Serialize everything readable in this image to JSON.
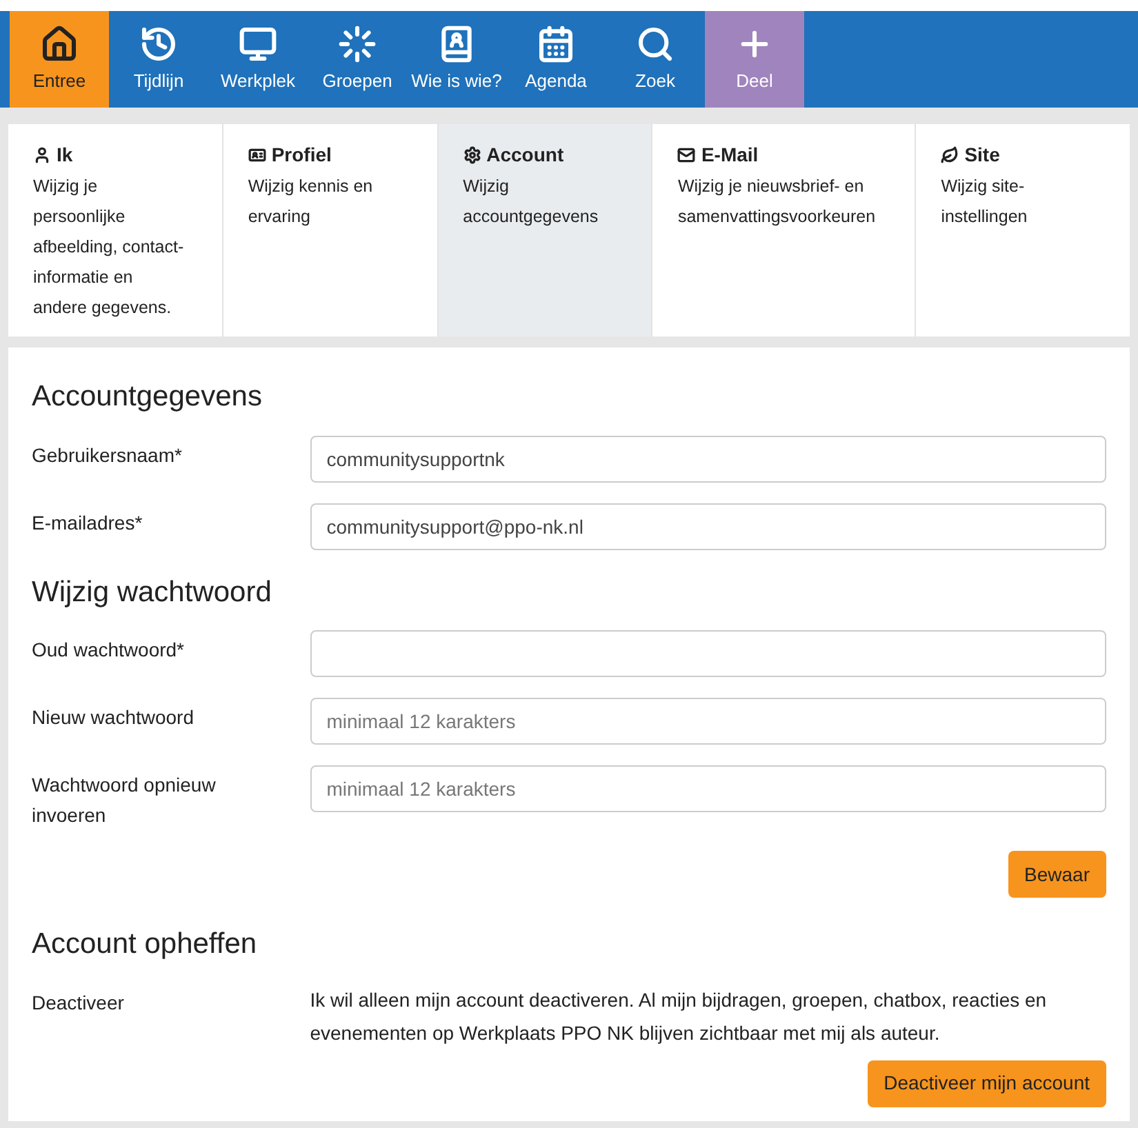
{
  "nav": [
    {
      "label": "Entree",
      "selected": true,
      "kind": "link"
    },
    {
      "label": "Tijdlijn",
      "selected": false,
      "kind": "link"
    },
    {
      "label": "Werkplek",
      "selected": false,
      "kind": "link"
    },
    {
      "label": "Groepen",
      "selected": false,
      "kind": "link"
    },
    {
      "label": "Wie is wie?",
      "selected": false,
      "kind": "link"
    },
    {
      "label": "Agenda",
      "selected": false,
      "kind": "link"
    },
    {
      "label": "Zoek",
      "selected": false,
      "kind": "link"
    },
    {
      "label": "Deel",
      "selected": false,
      "kind": "action"
    }
  ],
  "tabs": [
    {
      "title": "Ik",
      "description": "Wijzig je persoonlijke afbeelding, contact-informatie en andere gegevens.",
      "selected": false
    },
    {
      "title": "Profiel",
      "description": "Wijzig kennis en ervaring",
      "selected": false
    },
    {
      "title": "Account",
      "description": "Wijzig accountgegevens",
      "selected": true
    },
    {
      "title": "E-Mail",
      "description": "Wijzig je nieuwsbrief- en samenvattingsvoorkeuren",
      "selected": false
    },
    {
      "title": "Site",
      "description": "Wijzig site-instellingen",
      "selected": false
    }
  ],
  "sections": [
    {
      "heading": "Accountgegevens",
      "rows": [
        {
          "kind": "field",
          "label": "Gebruikersnaam*",
          "value": "communitysupportnk"
        },
        {
          "kind": "field",
          "label": "E-mailadres*",
          "value": "communitysupport@ppo-nk.nl"
        }
      ]
    },
    {
      "heading": "Wijzig wachtwoord",
      "rows": [
        {
          "kind": "field",
          "label": "Oud wachtwoord*"
        },
        {
          "kind": "field",
          "label": "Nieuw wachtwoord",
          "placeholder": "minimaal 12 karakters"
        },
        {
          "kind": "field",
          "label": "Wachtwoord opnieuw invoeren",
          "placeholder": "minimaal 12 karakters"
        },
        {
          "kind": "button",
          "label": "Bewaar"
        }
      ]
    },
    {
      "heading": "Account opheffen",
      "rows": [
        {
          "kind": "text",
          "label": "Deactiveer",
          "text": "Ik wil alleen mijn account deactiveren. Al mijn bijdragen, groepen, chatbox, reacties en evenementen op Werkplaats PPO NK blijven zichtbaar met mij als auteur."
        },
        {
          "kind": "button",
          "label": "Deactiveer mijn account"
        }
      ]
    }
  ]
}
